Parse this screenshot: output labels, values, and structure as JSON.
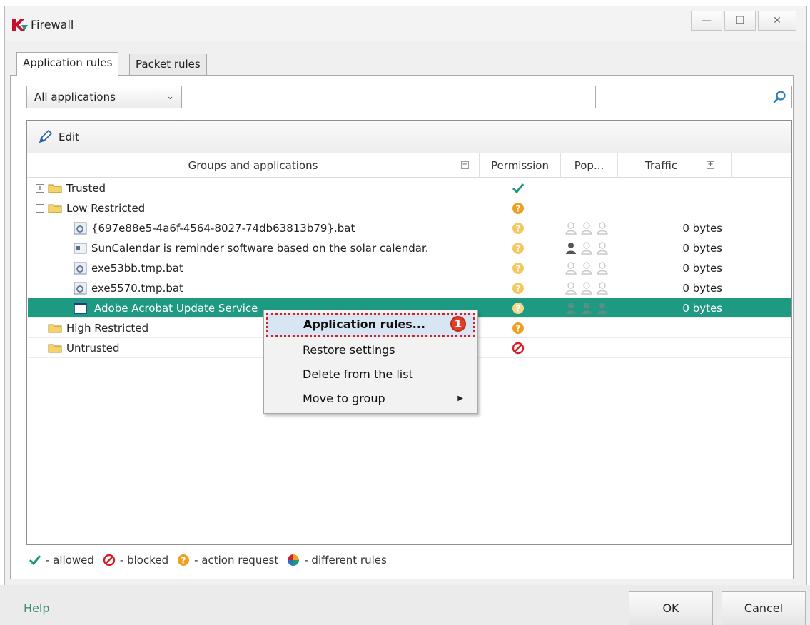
{
  "window": {
    "title": "Firewall",
    "accent": "#1f9a82"
  },
  "tabs": [
    {
      "label": "Application rules",
      "active": true
    },
    {
      "label": "Packet rules",
      "active": false
    }
  ],
  "filter": {
    "selected": "All applications",
    "search_value": ""
  },
  "toolbar": {
    "edit_label": "Edit"
  },
  "columns": {
    "name": "Groups and applications",
    "permission": "Permission",
    "popularity": "Pop...",
    "traffic": "Traffic"
  },
  "rows": [
    {
      "label": "Trusted",
      "kind": "group",
      "permission": "allowed",
      "expander": "+"
    },
    {
      "label": "Low Restricted",
      "kind": "group",
      "permission": "action-request",
      "expander": "−"
    },
    {
      "label": "{697e88e5-4a6f-4564-8027-74db63813b79}.bat",
      "kind": "app",
      "permission": "action-request",
      "popularity": 0,
      "traffic": "0 bytes"
    },
    {
      "label": "SunCalendar is reminder software based on the solar calendar.",
      "kind": "app",
      "permission": "action-request",
      "popularity": 1,
      "traffic": "0 bytes"
    },
    {
      "label": "exe53bb.tmp.bat",
      "kind": "app",
      "permission": "action-request",
      "popularity": 0,
      "traffic": "0 bytes"
    },
    {
      "label": "exe5570.tmp.bat",
      "kind": "app",
      "permission": "action-request",
      "popularity": 0,
      "traffic": "0 bytes"
    },
    {
      "label": "Adobe Acrobat Update Service",
      "kind": "app",
      "permission": "action-request",
      "popularity": 3,
      "traffic": "0 bytes",
      "selected": true
    },
    {
      "label": "High Restricted",
      "kind": "group",
      "permission": "action-request"
    },
    {
      "label": "Untrusted",
      "kind": "group",
      "permission": "blocked"
    }
  ],
  "context_menu": {
    "items": [
      {
        "label": "Application rules...",
        "highlighted": true,
        "badge": "1"
      },
      {
        "label": "Restore settings"
      },
      {
        "label": "Delete from the list"
      },
      {
        "label": "Move to group",
        "submenu": true
      }
    ]
  },
  "legend": {
    "allowed": "- allowed",
    "blocked": "- blocked",
    "action_request": "- action request",
    "different": "- different rules"
  },
  "footer": {
    "help": "Help",
    "ok": "OK",
    "cancel": "Cancel"
  },
  "colors": {
    "allowed": "#1a9a7d",
    "blocked": "#d3202a",
    "request": "#f0a020"
  }
}
